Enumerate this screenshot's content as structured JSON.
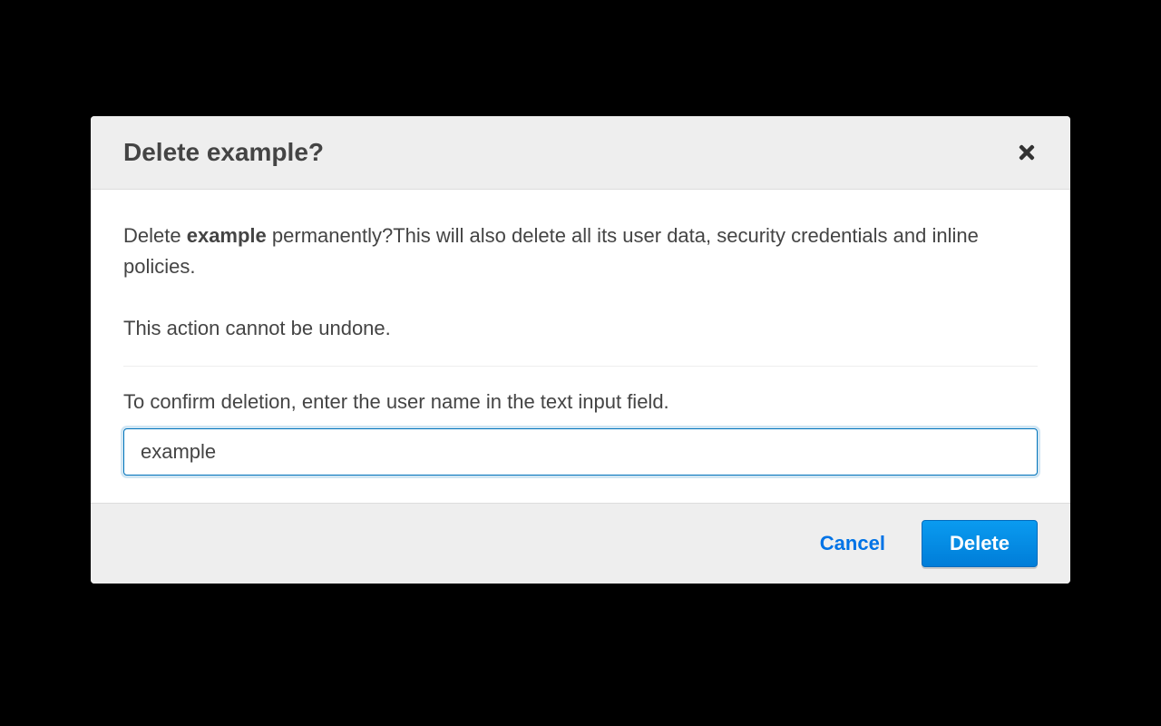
{
  "modal": {
    "title": "Delete example?",
    "warning_prefix": "Delete ",
    "warning_bold": "example",
    "warning_suffix": " permanently?This will also delete all its user data, security credentials and inline policies.",
    "undo_text": "This action cannot be undone.",
    "confirm_label": "To confirm deletion, enter the user name in the text input field.",
    "confirm_value": "example",
    "cancel_label": "Cancel",
    "delete_label": "Delete"
  }
}
